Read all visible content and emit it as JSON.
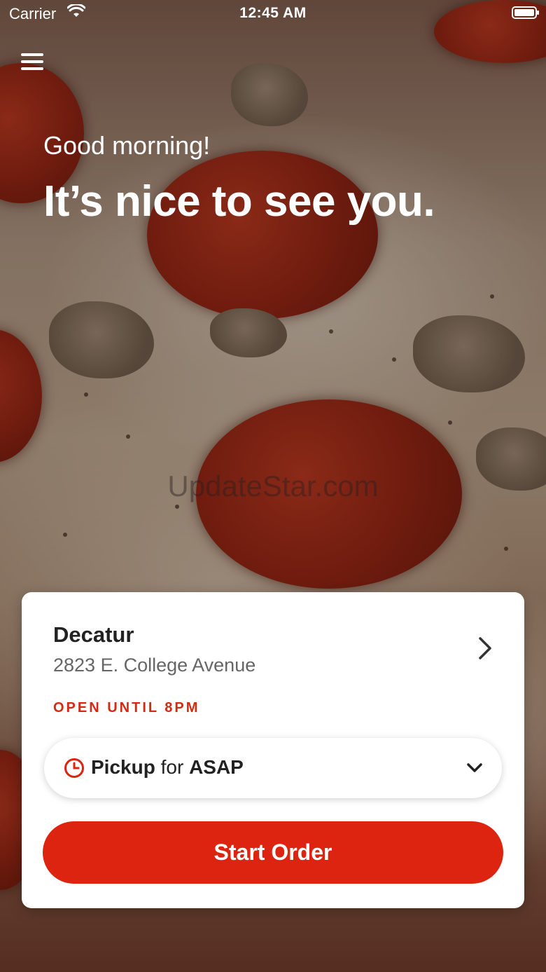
{
  "status_bar": {
    "carrier": "Carrier",
    "time": "12:45 AM"
  },
  "header": {
    "greeting": "Good morning!",
    "headline": "It’s nice to see you."
  },
  "watermark": "UpdateStar.com",
  "store_card": {
    "name": "Decatur",
    "address": "2823 E. College Avenue",
    "hours_status": "OPEN UNTIL 8PM",
    "order_type": "Pickup",
    "order_connector": "for",
    "order_time": "ASAP",
    "start_button_label": "Start Order"
  },
  "colors": {
    "accent": "#dc2410",
    "status_red": "#d42a12"
  },
  "icons": {
    "menu": "hamburger-menu-icon",
    "clock": "clock-icon",
    "chevron_right": "chevron-right-icon",
    "chevron_down": "chevron-down-icon",
    "wifi": "wifi-icon",
    "battery": "battery-icon"
  }
}
